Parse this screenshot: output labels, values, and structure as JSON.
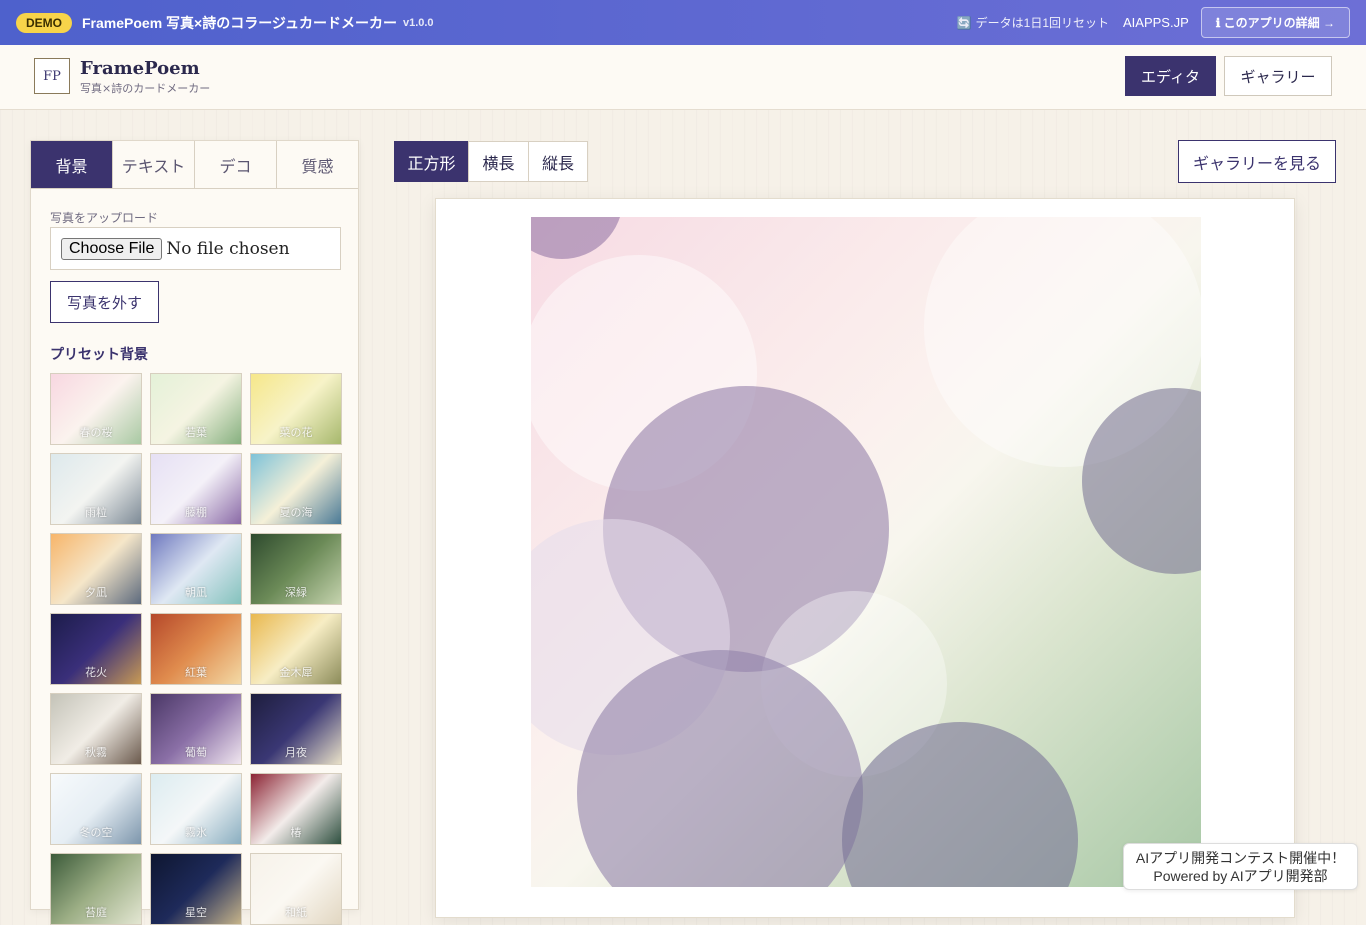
{
  "demo_bar": {
    "badge": "DEMO",
    "title": "FramePoem 写真×詩のコラージュカードメーカー",
    "version": "v1.0.0",
    "reset_icon": "refresh-icon",
    "reset_text": "データは1日1回リセット",
    "site": "AIAPPS.JP",
    "detail_button": "ℹ このアプリの詳細 →"
  },
  "header": {
    "logo": "FP",
    "app_name": "FramePoem",
    "subtitle": "写真×詩のカードメーカー",
    "nav": {
      "editor": "エディタ",
      "gallery": "ギャラリー"
    },
    "active_nav": "editor"
  },
  "panel": {
    "tabs": [
      "背景",
      "テキスト",
      "デコ",
      "質感"
    ],
    "active_tab": "背景",
    "upload_label": "写真をアップロード",
    "file_button": "Choose File",
    "file_status": "No file chosen",
    "remove_button": "写真を外す",
    "preset_title": "プリセット背景",
    "presets": [
      {
        "label": "春の桜",
        "colors": [
          "#f8d7e1",
          "#fbf3ee",
          "#a9c9a3"
        ]
      },
      {
        "label": "若葉",
        "colors": [
          "#e4f1d8",
          "#f5f4e2",
          "#86b07f"
        ]
      },
      {
        "label": "菜の花",
        "colors": [
          "#f6e78a",
          "#f7f3c8",
          "#a7b86d"
        ]
      },
      {
        "label": "雨粒",
        "colors": [
          "#dde9ec",
          "#f3f4f1",
          "#7d8a96"
        ]
      },
      {
        "label": "藤棚",
        "colors": [
          "#e6e0f4",
          "#f4f1f8",
          "#8a6aa6"
        ]
      },
      {
        "label": "夏の海",
        "colors": [
          "#7ec2d8",
          "#f5f0d8",
          "#4b7a96"
        ]
      },
      {
        "label": "夕凪",
        "colors": [
          "#f7b56a",
          "#f5e6c9",
          "#5d6a7d"
        ]
      },
      {
        "label": "朝凪",
        "colors": [
          "#6f79bf",
          "#dfe8f3",
          "#84c2bd"
        ]
      },
      {
        "label": "深緑",
        "colors": [
          "#2e4a2e",
          "#6b8a57",
          "#c5d3ae"
        ]
      },
      {
        "label": "花火",
        "colors": [
          "#1c1c4a",
          "#3a2f7a",
          "#c89a55"
        ]
      },
      {
        "label": "紅葉",
        "colors": [
          "#b5482a",
          "#e08c4e",
          "#f3d9a5"
        ]
      },
      {
        "label": "金木犀",
        "colors": [
          "#e9b84f",
          "#f7edc4",
          "#8c8c5a"
        ]
      },
      {
        "label": "秋霧",
        "colors": [
          "#c4c3b8",
          "#f1ede6",
          "#6b5a4d"
        ]
      },
      {
        "label": "葡萄",
        "colors": [
          "#4a3766",
          "#8a6fa6",
          "#f0e6ef"
        ]
      },
      {
        "label": "月夜",
        "colors": [
          "#1e1e3d",
          "#3a3774",
          "#e9e1c8"
        ]
      },
      {
        "label": "冬の空",
        "colors": [
          "#f7fafc",
          "#e6eef4",
          "#7d96ac"
        ]
      },
      {
        "label": "霧氷",
        "colors": [
          "#dcecf0",
          "#f4f7f8",
          "#8aaec0"
        ]
      },
      {
        "label": "椿",
        "colors": [
          "#8c2434",
          "#f3ecea",
          "#2f5040"
        ]
      },
      {
        "label": "苔庭",
        "colors": [
          "#3c5b3a",
          "#9cae85",
          "#e3e6d2"
        ]
      },
      {
        "label": "星空",
        "colors": [
          "#0e1630",
          "#1e2a5a",
          "#c6b48a"
        ]
      },
      {
        "label": "和紙",
        "colors": [
          "#f6f2ea",
          "#fbf8f2",
          "#e2d7c2"
        ]
      }
    ]
  },
  "main": {
    "ratios": [
      "正方形",
      "横長",
      "縦長"
    ],
    "active_ratio": "正方形",
    "gallery_link": "ギャラリーを見る"
  },
  "contest": {
    "line1": "AIアプリ開発コンテスト開催中！",
    "line2": "Powered by AIアプリ開発部"
  },
  "colors": {
    "accent": "#3b336e",
    "demo_bar_start": "#4e61cc",
    "demo_bar_end": "#6d6fd6",
    "badge": "#f7d44a"
  }
}
